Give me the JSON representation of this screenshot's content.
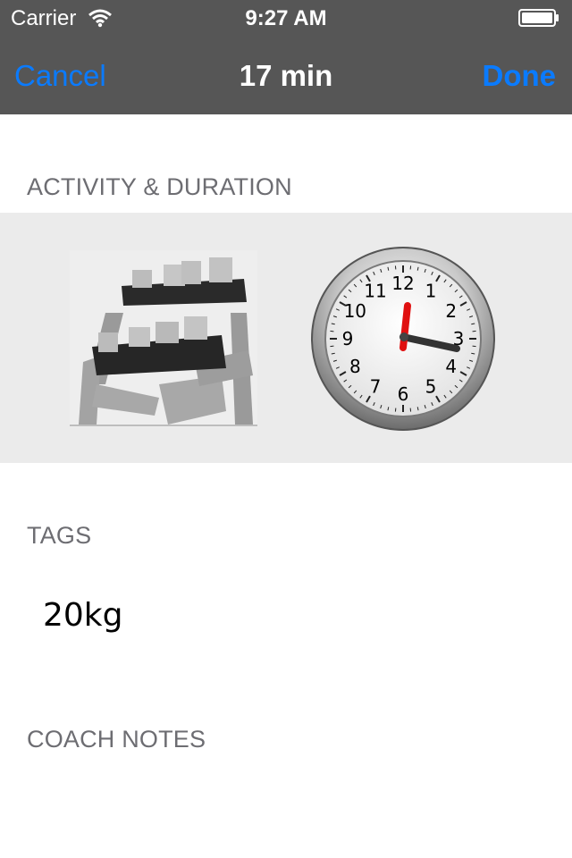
{
  "status_bar": {
    "carrier": "Carrier",
    "time": "9:27 AM",
    "icons": [
      "wifi-icon",
      "battery-icon"
    ]
  },
  "nav": {
    "cancel_label": "Cancel",
    "title": "17 min",
    "done_label": "Done",
    "accent_color": "#0a7bff",
    "bar_color": "#565656"
  },
  "sections": {
    "activity_header": "ACTIVITY & DURATION",
    "tags_header": "TAGS",
    "notes_header": "COACH NOTES"
  },
  "activity": {
    "icon": "dumbbell-rack-icon",
    "duration_icon": "clock-icon",
    "clock_numbers": [
      "12",
      "1",
      "2",
      "3",
      "4",
      "5",
      "6",
      "7",
      "8",
      "9",
      "10",
      "11"
    ]
  },
  "tags": {
    "value": "20kg"
  }
}
